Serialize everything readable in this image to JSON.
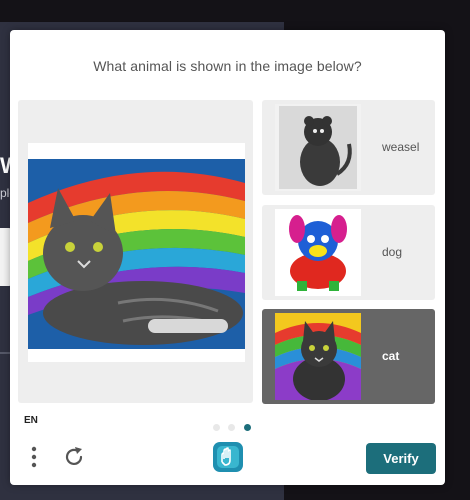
{
  "background": {
    "fragment_big": "W",
    "fragment_small": "ple"
  },
  "challenge": {
    "prompt": "What animal is shown in the image below?",
    "main_image_icon": "cat-painting-image",
    "options": [
      {
        "label": "weasel",
        "icon": "weasel-image",
        "selected": false
      },
      {
        "label": "dog",
        "icon": "dog-image",
        "selected": false
      },
      {
        "label": "cat",
        "icon": "cat-image",
        "selected": true
      }
    ],
    "language": "EN",
    "pagination": {
      "total": 3,
      "current": 3
    },
    "verify_label": "Verify"
  },
  "colors": {
    "accent": "#1c6e7b",
    "selected_option_bg": "#666666",
    "option_bg": "#eeeeee"
  }
}
